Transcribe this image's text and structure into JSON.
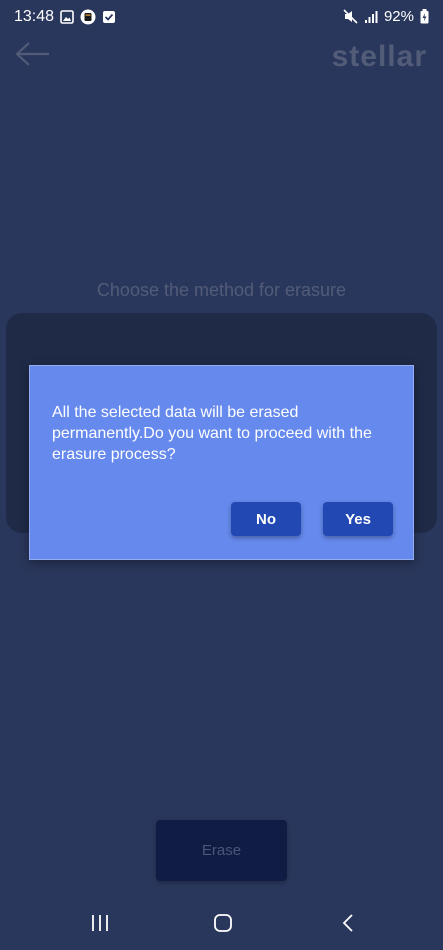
{
  "status_bar": {
    "time": "13:48",
    "battery": "92%",
    "icons_left": [
      "gallery-icon",
      "app-notification-icon",
      "check-box-icon"
    ],
    "icons_right": [
      "mute-icon",
      "signal-icon",
      "battery-icon"
    ]
  },
  "app_bar": {
    "logo": "stellar",
    "back_icon": "back-arrow-icon"
  },
  "main": {
    "heading": "Choose the method for erasure",
    "erase_label": "Erase"
  },
  "dialog": {
    "message": "All the selected data will be erased permanently.Do you want to proceed with the erasure process?",
    "no_label": "No",
    "yes_label": "Yes"
  },
  "nav_bar": {
    "items": [
      "recents-icon",
      "home-icon",
      "back-icon"
    ]
  },
  "colors": {
    "background": "#2a375c",
    "dialog": "#6589ec",
    "dialog_button": "#2248b4",
    "erase_button": "#111c44"
  }
}
